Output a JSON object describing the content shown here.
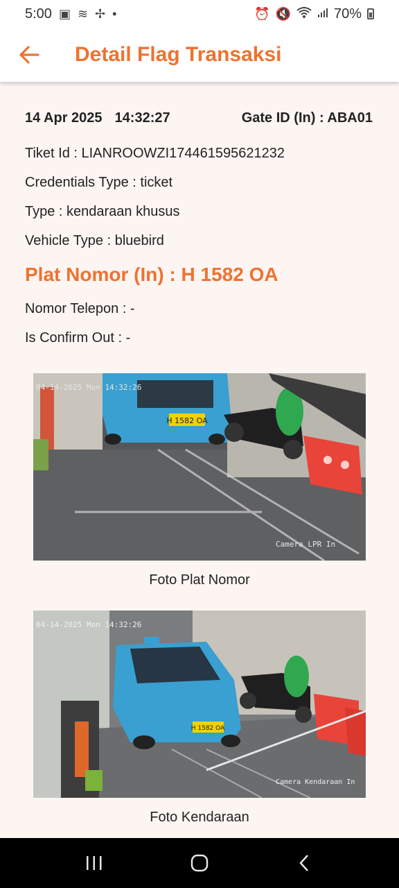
{
  "status_bar": {
    "time": "5:00",
    "battery": "70%"
  },
  "app_bar": {
    "title": "Detail Flag Transaksi"
  },
  "detail": {
    "date": "14 Apr 2025",
    "time": "14:32:27",
    "gate": "Gate ID (In) : ABA01",
    "ticket": "Tiket Id : LIANROOWZI174461595621232",
    "credentials": "Credentials Type : ticket",
    "type": "Type : kendaraan khusus",
    "vehicle": "Vehicle Type : bluebird",
    "plate": "Plat Nomor (In) : H 1582 OA",
    "phone": "Nomor Telepon : -",
    "confirm_out": "Is Confirm Out : -"
  },
  "photos": {
    "plate_caption": "Foto Plat Nomor",
    "vehicle_caption": "Foto Kendaraan",
    "plate_stamp": "04-14-2025 Mon 14:32:26",
    "plate_cam": "Camera LPR In",
    "vehicle_stamp": "04-14-2025 Mon 14:32:26",
    "vehicle_cam": "Camera Kendaraan In",
    "license_text": "H 1582 OA"
  },
  "colors": {
    "accent": "#ee7231",
    "background": "#fdf5f2",
    "taxi_blue": "#3a9fd1"
  },
  "icons": {
    "back": "arrow-left-icon",
    "recents": "recents-icon",
    "home": "home-icon",
    "nav_back": "chevron-left-icon"
  }
}
